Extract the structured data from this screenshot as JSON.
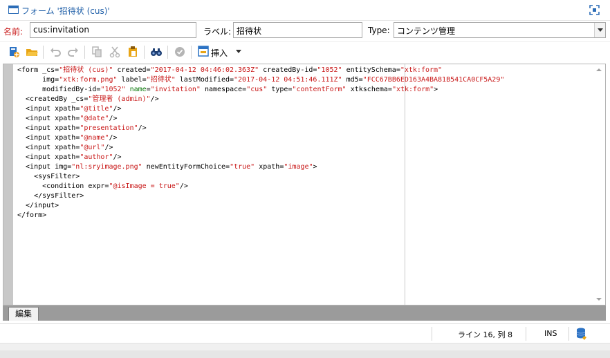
{
  "window": {
    "title": "フォーム '招待状 (cus)'"
  },
  "fields": {
    "name_label": "名前:",
    "name_value": "cus:invitation",
    "label_label": "ラベル:",
    "label_value": "招待状",
    "type_label": "Type:",
    "type_value": "コンテンツ管理"
  },
  "toolbar": {
    "insert_label": "挿入"
  },
  "editor": {
    "lines": [
      [
        {
          "t": "<form _cs="
        },
        {
          "t": "\"招待状 (cus)\"",
          "c": "s"
        },
        {
          "t": " created="
        },
        {
          "t": "\"2017-04-12 04:46:02.363Z\"",
          "c": "s"
        },
        {
          "t": " createdBy-id="
        },
        {
          "t": "\"1052\"",
          "c": "s"
        },
        {
          "t": " entitySchema="
        },
        {
          "t": "\"xtk:form\"",
          "c": "s"
        }
      ],
      [
        {
          "t": "      img="
        },
        {
          "t": "\"xtk:form.png\"",
          "c": "s"
        },
        {
          "t": " label="
        },
        {
          "t": "\"招待状\"",
          "c": "s"
        },
        {
          "t": " lastModified="
        },
        {
          "t": "\"2017-04-12 04:51:46.111Z\"",
          "c": "s"
        },
        {
          "t": " md5="
        },
        {
          "t": "\"FCC67BB6ED163A4BA81B541CA0CF5A29\"",
          "c": "s"
        }
      ],
      [
        {
          "t": "      modifiedBy-id="
        },
        {
          "t": "\"1052\"",
          "c": "s"
        },
        {
          "t": " "
        },
        {
          "t": "name",
          "c": "a"
        },
        {
          "t": "="
        },
        {
          "t": "\"invitation\"",
          "c": "s"
        },
        {
          "t": " namespace="
        },
        {
          "t": "\"cus\"",
          "c": "s"
        },
        {
          "t": " type="
        },
        {
          "t": "\"contentForm\"",
          "c": "s"
        },
        {
          "t": " xtkschema="
        },
        {
          "t": "\"xtk:form\"",
          "c": "s"
        },
        {
          "t": ">"
        }
      ],
      [
        {
          "t": "  <createdBy _cs="
        },
        {
          "t": "\"管理者 (admin)\"",
          "c": "s"
        },
        {
          "t": "/>"
        }
      ],
      [
        {
          "t": "  <input xpath="
        },
        {
          "t": "\"@title\"",
          "c": "s"
        },
        {
          "t": "/>"
        }
      ],
      [
        {
          "t": "  <input xpath="
        },
        {
          "t": "\"@date\"",
          "c": "s"
        },
        {
          "t": "/>"
        }
      ],
      [
        {
          "t": "  <input xpath="
        },
        {
          "t": "\"presentation\"",
          "c": "s"
        },
        {
          "t": "/>"
        }
      ],
      [
        {
          "t": "  <input xpath="
        },
        {
          "t": "\"@name\"",
          "c": "s"
        },
        {
          "t": "/>"
        }
      ],
      [
        {
          "t": "  <input xpath="
        },
        {
          "t": "\"@url\"",
          "c": "s"
        },
        {
          "t": "/>"
        }
      ],
      [
        {
          "t": "  <input xpath="
        },
        {
          "t": "\"author\"",
          "c": "s"
        },
        {
          "t": "/>"
        }
      ],
      [
        {
          "t": "  <input img="
        },
        {
          "t": "\"nl:sryimage.png\"",
          "c": "s"
        },
        {
          "t": " newEntityFormChoice="
        },
        {
          "t": "\"true\"",
          "c": "s"
        },
        {
          "t": " xpath="
        },
        {
          "t": "\"image\"",
          "c": "s"
        },
        {
          "t": ">"
        }
      ],
      [
        {
          "t": "    <sysFilter>"
        }
      ],
      [
        {
          "t": "      <condition expr="
        },
        {
          "t": "\"@isImage = true\"",
          "c": "s"
        },
        {
          "t": "/>"
        }
      ],
      [
        {
          "t": "    </sysFilter>"
        }
      ],
      [
        {
          "t": "  </input>"
        }
      ],
      [
        {
          "t": "</form>"
        }
      ]
    ]
  },
  "tabs": [
    {
      "label": "編集"
    }
  ],
  "status": {
    "cursor": "ライン 16, 列 8",
    "mode": "INS"
  },
  "colors": {
    "string": "#c81616",
    "attribute": "#0d7a0d",
    "accent": "#1f5fa8"
  }
}
